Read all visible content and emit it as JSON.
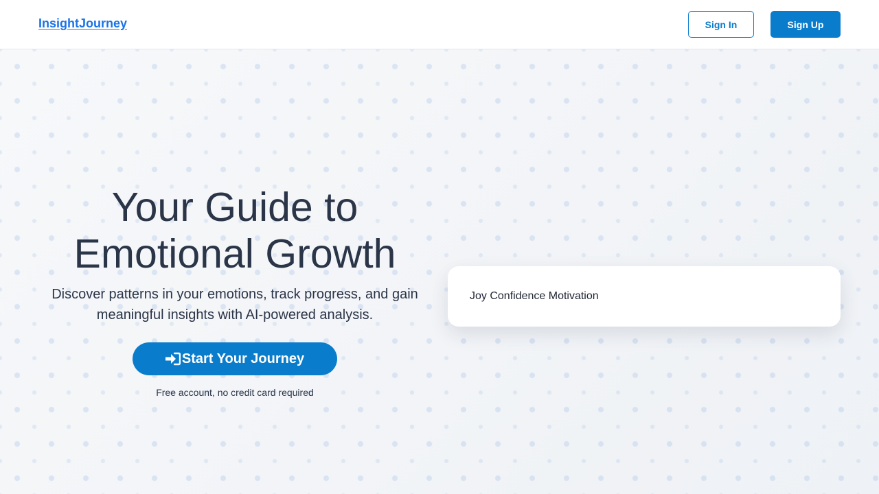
{
  "header": {
    "logo": "InsightJourney",
    "sign_in_label": "Sign In",
    "sign_up_label": "Sign Up"
  },
  "hero": {
    "title_line1": "Your Guide to",
    "title_line2": "Emotional Growth",
    "subtitle_line1": "Discover patterns in your emotions, track progress, and gain",
    "subtitle_line2": "meaningful insights with AI-powered analysis.",
    "cta_label": "Start Your Journey",
    "cta_icon": "sign-in-icon",
    "cta_note": "Free account, no credit card required"
  },
  "emotion_card": {
    "text": "Joy Confidence Motivation"
  },
  "colors": {
    "brand": "#1a73e8",
    "primary": "#0a7ccc",
    "heading": "#2b3548"
  }
}
